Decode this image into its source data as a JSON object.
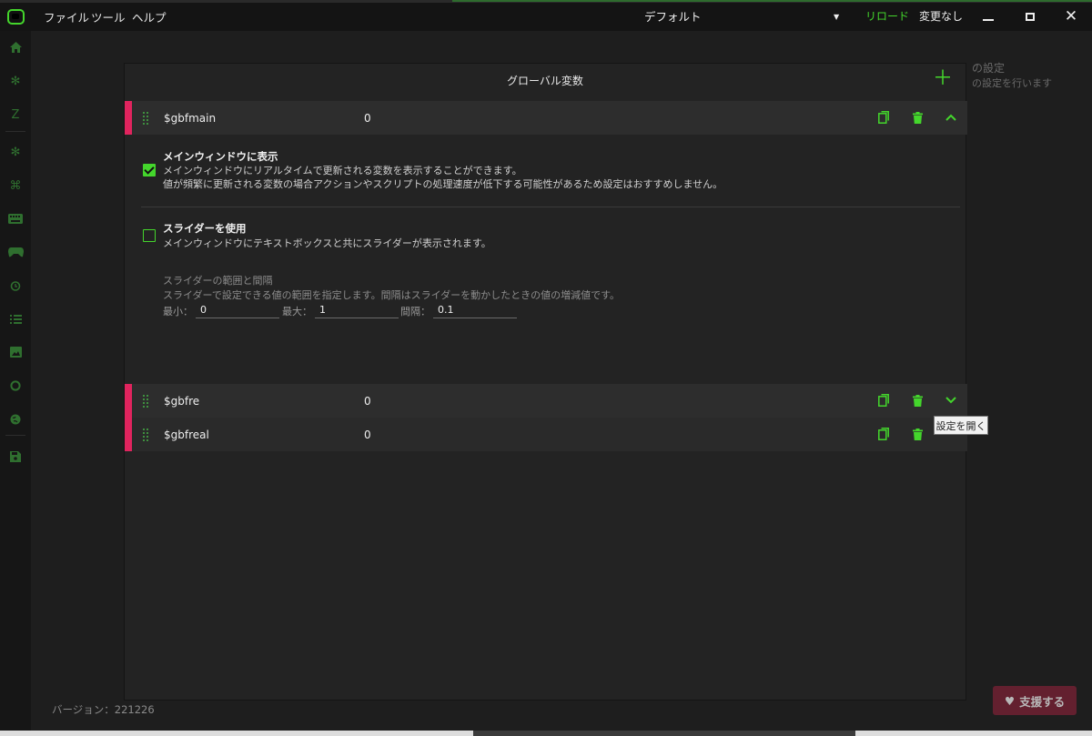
{
  "menu": {
    "file": "ファイル",
    "tools": "ツール",
    "help": "ヘルプ"
  },
  "titlebar": {
    "profile": "デフォルト",
    "profile_caret": "▼",
    "reload": "リロード",
    "status": "変更なし"
  },
  "background": {
    "settings_title_fragment": "の設定",
    "settings_desc_fragment": "の設定を行います",
    "version": "バージョン：221226",
    "support_label": "支援する"
  },
  "dialog": {
    "title": "グローバル変数",
    "add_symbol": "＋",
    "variables": [
      {
        "name": "$gbfmain",
        "value": "0",
        "expanded": true
      },
      {
        "name": "$gbfre",
        "value": "0",
        "expanded": false
      },
      {
        "name": "$gbfreal",
        "value": "0",
        "expanded": false
      }
    ],
    "options": {
      "show_main": {
        "checked": true,
        "title": "メインウィンドウに表示",
        "desc1": "メインウィンドウにリアルタイムで更新される変数を表示することができます。",
        "desc2": "値が頻繁に更新される変数の場合アクションやスクリプトの処理速度が低下する可能性があるため設定はおすすめしません。"
      },
      "use_slider": {
        "checked": false,
        "title": "スライダーを使用",
        "desc": "メインウィンドウにテキストボックスと共にスライダーが表示されます。"
      },
      "range": {
        "title": "スライダーの範囲と間隔",
        "desc": "スライダーで設定できる値の範囲を指定します。間隔はスライダーを動かしたときの値の増減値です。",
        "min_label": "最小：",
        "min_value": "0",
        "max_label": "最大：",
        "max_value": "1",
        "step_label": "間隔：",
        "step_value": "0.1"
      }
    }
  },
  "tooltip": "設定を開く",
  "colors": {
    "accent_green": "#44d62c",
    "accent_pink": "#e0245e"
  }
}
